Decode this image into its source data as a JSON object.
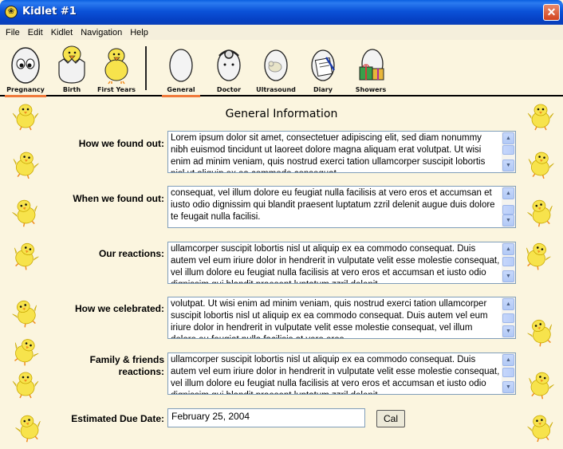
{
  "window": {
    "title": "Kidlet #1",
    "app_icon": "❀",
    "close_glyph": "✕"
  },
  "menu": [
    "File",
    "Edit",
    "Kidlet",
    "Navigation",
    "Help"
  ],
  "toolbar": {
    "group1": [
      {
        "label": "Pregnancy",
        "icon": "egg-eyes-icon",
        "selected": true
      },
      {
        "label": "Birth",
        "icon": "hatching-chick-icon",
        "selected": false
      },
      {
        "label": "First Years",
        "icon": "chick-icon",
        "selected": false
      }
    ],
    "group2": [
      {
        "label": "General",
        "icon": "plain-egg-icon",
        "selected": true
      },
      {
        "label": "Doctor",
        "icon": "doctor-egg-icon",
        "selected": false
      },
      {
        "label": "Ultrasound",
        "icon": "ultrasound-egg-icon",
        "selected": false
      },
      {
        "label": "Diary",
        "icon": "diary-egg-icon",
        "selected": false
      },
      {
        "label": "Showers",
        "icon": "gift-egg-icon",
        "selected": false
      }
    ]
  },
  "form": {
    "heading": "General Information",
    "fields": [
      {
        "label": "How we found out:",
        "text": "Lorem ipsum dolor sit amet, consectetuer adipiscing elit, sed diam nonummy nibh euismod tincidunt ut laoreet dolore magna aliquam erat volutpat. Ut wisi enim ad minim veniam, quis nostrud exerci tation ullamcorper suscipit lobortis nisl ut aliquip ex ea commodo consequat."
      },
      {
        "label": "When we found out:",
        "text": "consequat, vel illum dolore eu feugiat nulla facilisis at vero eros et accumsan et iusto odio dignissim qui blandit praesent luptatum zzril delenit augue duis dolore te feugait nulla facilisi."
      },
      {
        "label": "Our reactions:",
        "text": "ullamcorper suscipit lobortis nisl ut aliquip ex ea commodo consequat. Duis autem vel eum iriure dolor in hendrerit in vulputate velit esse molestie consequat, vel illum dolore eu feugiat nulla facilisis at vero eros et accumsan et iusto odio dignissim qui blandit praesent luptatum zzril delenit."
      },
      {
        "label": "How we celebrated:",
        "text": "volutpat. Ut wisi enim ad minim veniam, quis nostrud exerci tation ullamcorper suscipit lobortis nisl ut aliquip ex ea commodo consequat. Duis autem vel eum iriure dolor in hendrerit in vulputate velit esse molestie consequat, vel illum dolore eu feugiat nulla facilisis at vero eros."
      },
      {
        "label": "Family & friends\nreactions:",
        "text": "ullamcorper suscipit lobortis nisl ut aliquip ex ea commodo consequat. Duis autem vel eum iriure dolor in hendrerit in vulputate velit esse molestie consequat, vel illum dolore eu feugiat nulla facilisis at vero eros et accumsan et iusto odio dignissim qui blandit praesent luptatum zzril delenit."
      }
    ],
    "due_date_label": "Estimated Due Date:",
    "due_date_value": "February 25, 2004",
    "cal_button": "Cal"
  },
  "colors": {
    "accent_underline": "#f07a3c",
    "background": "#fbf5df",
    "chick": "#f7e34c"
  }
}
